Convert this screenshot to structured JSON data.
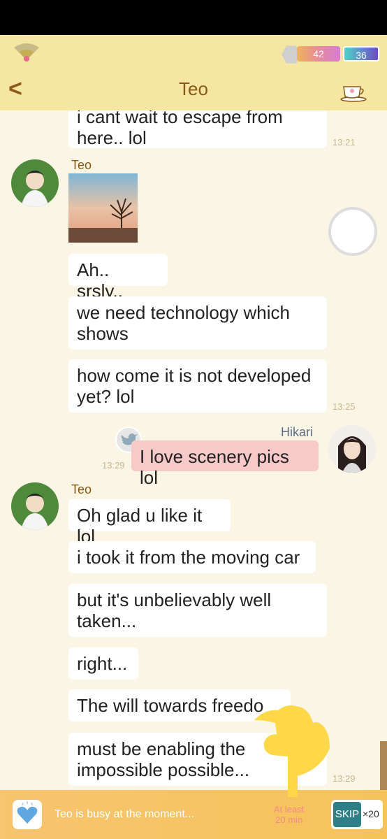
{
  "status": {
    "heart_count": "42",
    "diamond_count": "36"
  },
  "header": {
    "title": "Teo"
  },
  "messages": {
    "m0": "i cant wait to escape from",
    "m0b": "here.. lol",
    "t0": "13:21",
    "teo_name_1": "Teo",
    "m1": "Ah.. srsly..",
    "m2": "we need technology which shows",
    "m3": "how come it is not developed yet? lol",
    "t3": "13:25",
    "hikari_name": "Hikari",
    "m4": "I love scenery pics lol",
    "t4": "13:29",
    "teo_name_2": "Teo",
    "m5": "Oh glad u like it lol",
    "m6": "i took it from the moving car",
    "m7": "but it's unbelievably well taken...",
    "m8": "right...",
    "m9": "The will towards freedo",
    "m10": "must be enabling the impossible possible...",
    "t10": "13:29"
  },
  "footer": {
    "busy_text": "Teo is busy at the moment...",
    "at_least": "At least",
    "minutes": "20 min",
    "skip_label": "SKIP",
    "skip_mult": "×20"
  },
  "colors": {
    "header_bg": "#f5e6a4",
    "chat_bg": "#fbf5e6",
    "accent": "#8a5a16",
    "own_bubble": "#f8c9c9",
    "footer_bg": "#f6c35a"
  }
}
